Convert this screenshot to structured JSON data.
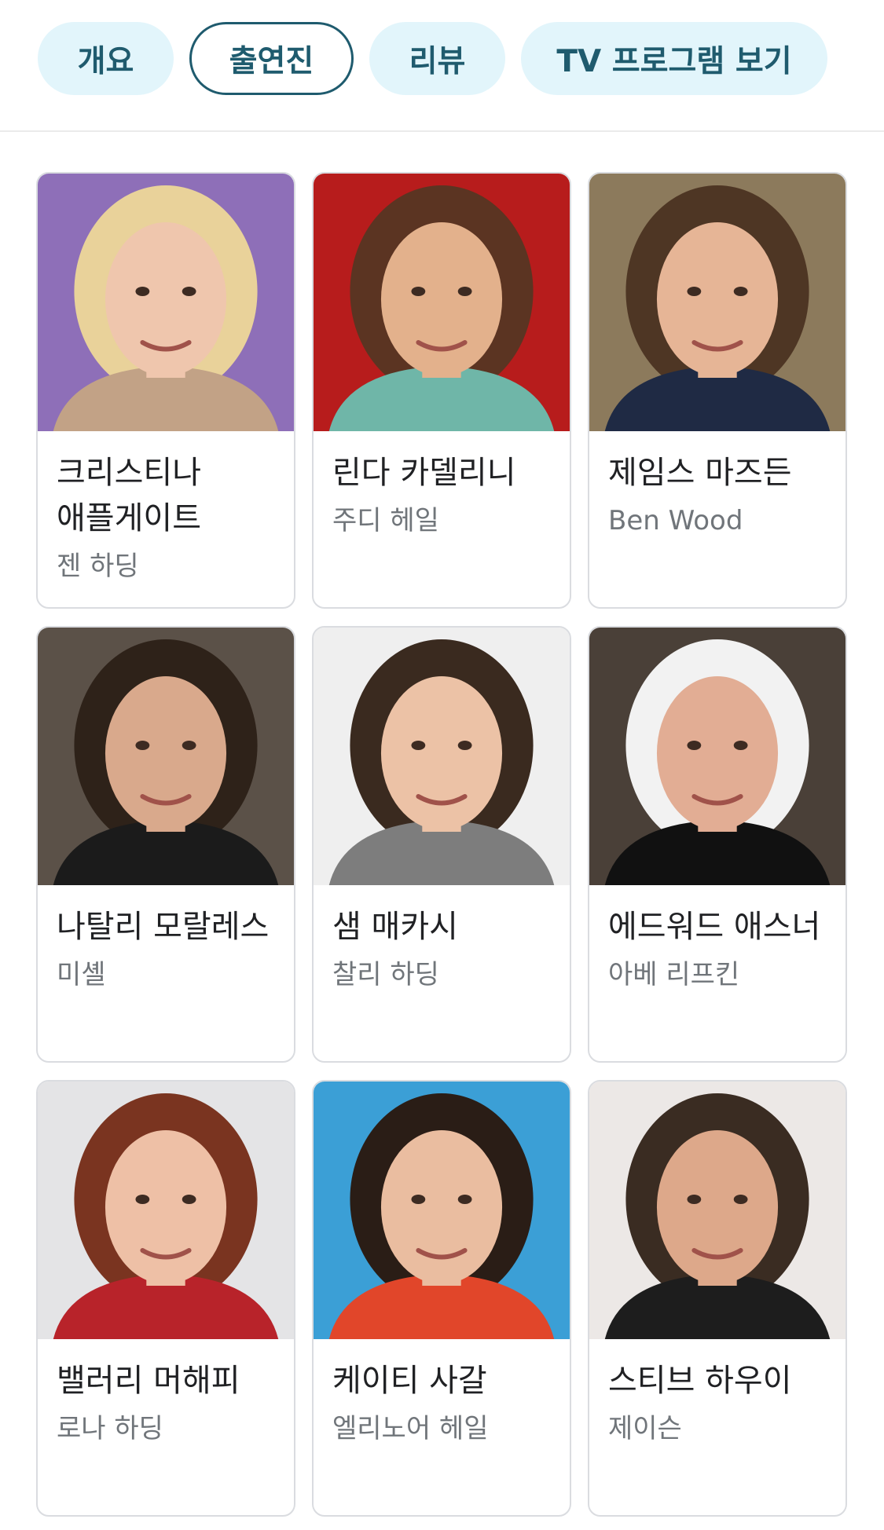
{
  "tabs": [
    {
      "label": "개요",
      "active": false
    },
    {
      "label": "출연진",
      "active": true
    },
    {
      "label": "리뷰",
      "active": false
    },
    {
      "label": "TV 프로그램 보기",
      "active": false
    }
  ],
  "cast": [
    {
      "actor": "크리스티나 애플게이트",
      "role": "젠 하딩",
      "bg": "#8e6fb8",
      "skin": "#efc6ad",
      "hair": "#e9d29a",
      "shirt": "#c2a286"
    },
    {
      "actor": "린다 카델리니",
      "role": "주디 헤일",
      "bg": "#b71c1c",
      "skin": "#e3b18c",
      "hair": "#5b3422",
      "shirt": "#6fb6a8"
    },
    {
      "actor": "제임스 마즈든",
      "role": "Ben Wood",
      "bg": "#8c7a5c",
      "skin": "#e6b596",
      "hair": "#4e3624",
      "shirt": "#1f2a44"
    },
    {
      "actor": "나탈리 모랄레스",
      "role": "미셸",
      "bg": "#5b5148",
      "skin": "#d9a98c",
      "hair": "#2e2219",
      "shirt": "#1b1b1b"
    },
    {
      "actor": "샘 매카시",
      "role": "찰리 하딩",
      "bg": "#efefef",
      "skin": "#ecc2a6",
      "hair": "#3a2a1f",
      "shirt": "#7d7d7d"
    },
    {
      "actor": "에드워드 애스너",
      "role": "아베 리프킨",
      "bg": "#4a4038",
      "skin": "#e2ad94",
      "hair": "#f2f2f2",
      "shirt": "#111111"
    },
    {
      "actor": "밸러리 머해피",
      "role": "로나 하딩",
      "bg": "#e4e4e6",
      "skin": "#eec0a6",
      "hair": "#7a3420",
      "shirt": "#b8232a"
    },
    {
      "actor": "케이티 사갈",
      "role": "엘리노어 헤일",
      "bg": "#3b9fd6",
      "skin": "#eabda0",
      "hair": "#2a1d16",
      "shirt": "#e1462a"
    },
    {
      "actor": "스티브 하우이",
      "role": "제이슨",
      "bg": "#ece8e6",
      "skin": "#dda88a",
      "hair": "#3a2c22",
      "shirt": "#1d1d1d"
    }
  ]
}
